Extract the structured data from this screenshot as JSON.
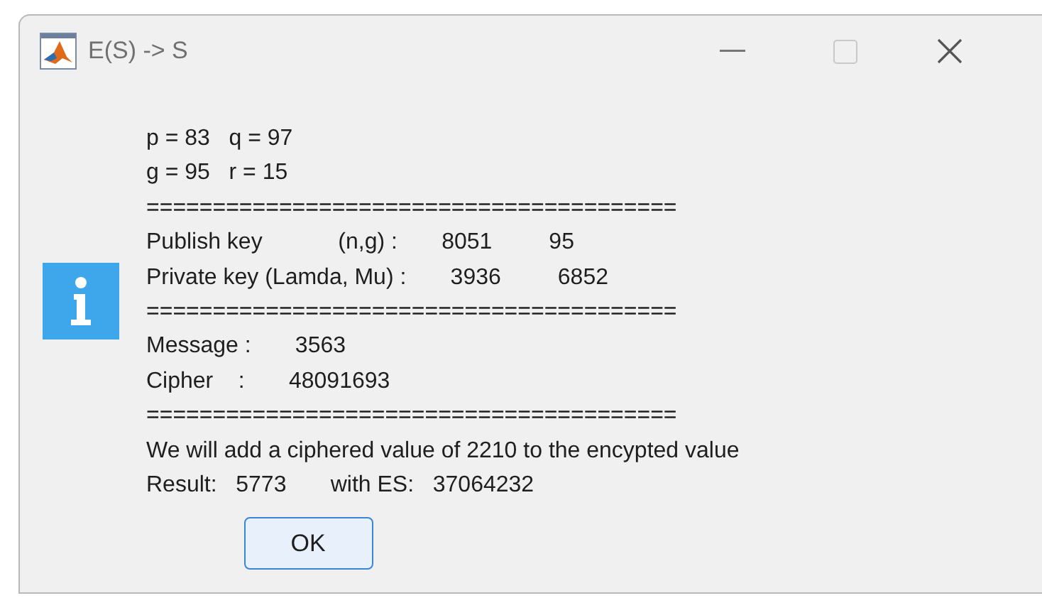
{
  "window": {
    "title": "E(S) -> S"
  },
  "message_lines": [
    "p = 83   q = 97",
    "g = 95   r = 15",
    "========================================",
    "Publish key            (n,g) :       8051         95",
    "Private key (Lamda, Mu) :       3936         6852",
    "========================================",
    "Message :       3563",
    "Cipher    :       48091693",
    "========================================",
    "We will add a ciphered value of 2210 to the encypted value",
    "Result:   5773       with ES:   37064232"
  ],
  "buttons": [
    {
      "label": "OK"
    }
  ]
}
